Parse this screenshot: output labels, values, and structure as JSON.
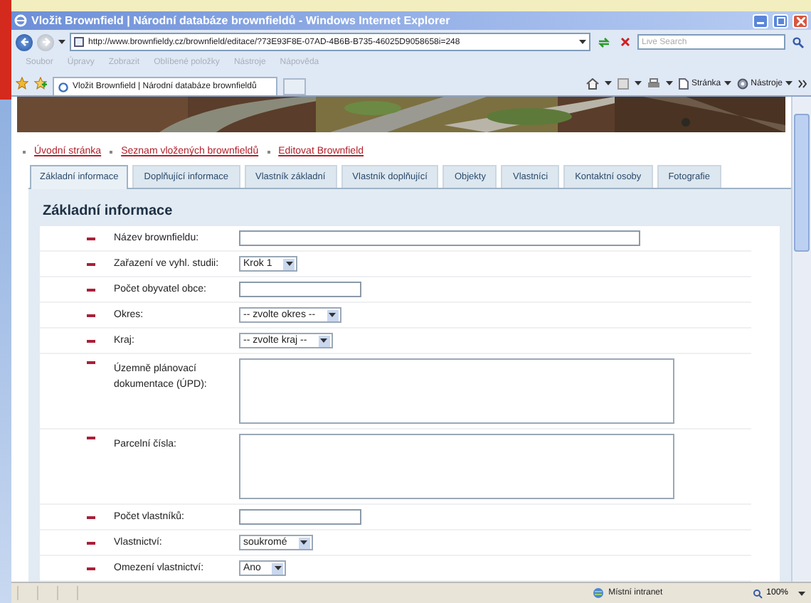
{
  "window": {
    "title": "Vložit Brownfield | Národní databáze brownfieldů - Windows Internet Explorer"
  },
  "address_bar": {
    "url": "http://www.brownfieldy.cz/brownfield/editace/?73E93F8E-07AD-4B6B-B735-46025D9058658i=248"
  },
  "search": {
    "placeholder": "Live Search"
  },
  "menu": [
    "Soubor",
    "Úpravy",
    "Zobrazit",
    "Oblíbené položky",
    "Nástroje",
    "Nápověda"
  ],
  "browser_tab": {
    "title": "Vložit Brownfield | Národní databáze brownfieldů"
  },
  "command_bar": [
    {
      "kind": "page",
      "label": "Stránka"
    },
    {
      "kind": "tools",
      "label": "Nástroje"
    }
  ],
  "breadcrumbs": [
    "Úvodní stránka",
    "Seznam vložených brownfieldů",
    "Editovat Brownfield"
  ],
  "tabs": [
    {
      "label": "Základní informace",
      "selected": true
    },
    {
      "label": "Doplňující informace",
      "selected": false
    },
    {
      "label": "Vlastník základní",
      "selected": false
    },
    {
      "label": "Vlastník doplňující",
      "selected": false
    },
    {
      "label": "Objekty",
      "selected": false
    },
    {
      "label": "Vlastníci",
      "selected": false
    },
    {
      "label": "Kontaktní osoby",
      "selected": false
    },
    {
      "label": "Fotografie",
      "selected": false
    }
  ],
  "heading": "Základní informace",
  "fields": [
    {
      "label": "Název brownfieldu:",
      "kind": "wide_text"
    },
    {
      "label": "Zařazení ve vyhl. studii:",
      "kind": "select",
      "value": "Krok 1"
    },
    {
      "label": "Počet obyvatel obce:",
      "kind": "text"
    },
    {
      "label": "Okres:",
      "kind": "select",
      "value": "-- zvolte okres --"
    },
    {
      "label": "Kraj:",
      "kind": "select",
      "value": "-- zvolte kraj --"
    },
    {
      "label": "Územně plánovací dokumentace (ÚPD):",
      "kind": "textarea"
    },
    {
      "label": "Parcelní čísla:",
      "kind": "textarea"
    },
    {
      "label": "Počet vlastníků:",
      "kind": "text"
    },
    {
      "label": "Vlastnictví:",
      "kind": "select",
      "value": "soukromé"
    },
    {
      "label": "Omezení vlastnictví:",
      "kind": "select",
      "value": "Ano"
    }
  ],
  "status_bar": {
    "zone": "Místní intranet",
    "zoom": "100%"
  }
}
